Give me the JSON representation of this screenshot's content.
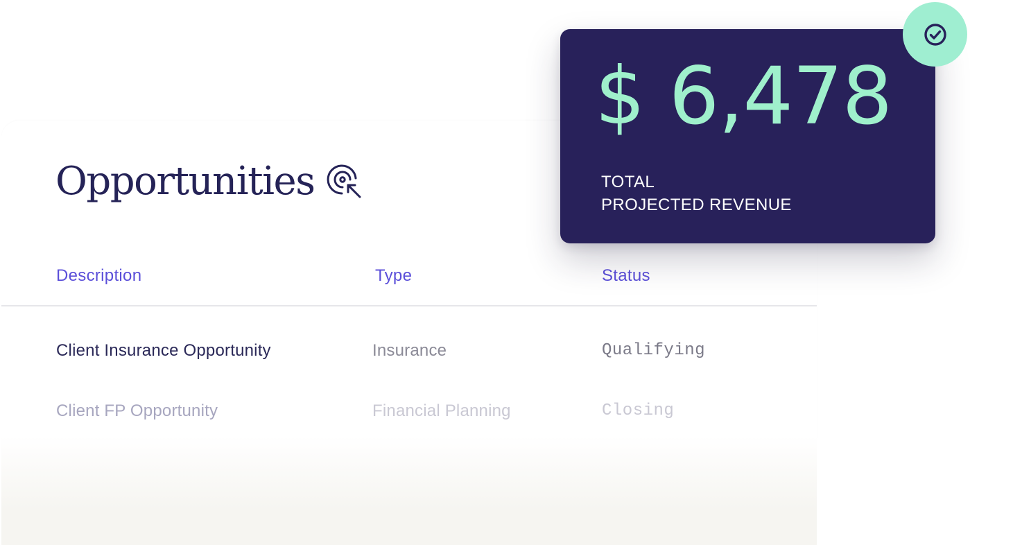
{
  "opportunities": {
    "title": "Opportunities",
    "title_icon": "target-cursor-icon",
    "columns": {
      "description": "Description",
      "type": "Type",
      "status": "Status"
    },
    "rows": [
      {
        "description": "Client Insurance Opportunity",
        "type": "Insurance",
        "status": "Qualifying"
      },
      {
        "description": "Client FP Opportunity",
        "type": "Financial Planning",
        "status": "Closing"
      }
    ]
  },
  "revenue_card": {
    "amount": "$ 6,478",
    "label_line1": "TOTAL",
    "label_line2": "PROJECTED REVENUE",
    "badge_icon": "check-circle-icon"
  },
  "colors": {
    "navy": "#28215a",
    "mint": "#9ff0cc",
    "accent_purple": "#5b4fd9",
    "title_text": "#252357"
  }
}
